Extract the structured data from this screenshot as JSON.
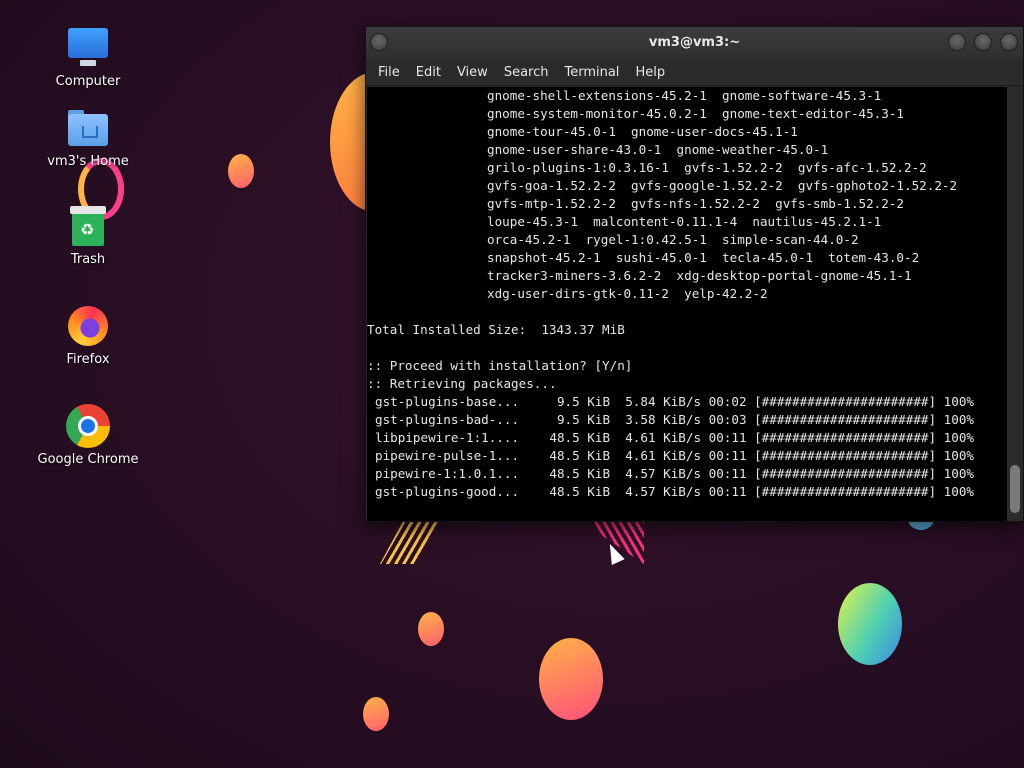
{
  "desktop": {
    "icons": [
      {
        "label": "Computer",
        "icon": "computer-icon"
      },
      {
        "label": "vm3's Home",
        "icon": "home-folder-icon"
      },
      {
        "label": "Trash",
        "icon": "trash-icon"
      },
      {
        "label": "Firefox",
        "icon": "firefox-icon"
      },
      {
        "label": "Google Chrome",
        "icon": "chrome-icon"
      }
    ]
  },
  "window": {
    "title": "vm3@vm3:~",
    "menu": [
      "File",
      "Edit",
      "View",
      "Search",
      "Terminal",
      "Help"
    ]
  },
  "terminal": {
    "package_lines": [
      "gnome-shell-extensions-45.2-1  gnome-software-45.3-1",
      "gnome-system-monitor-45.0.2-1  gnome-text-editor-45.3-1",
      "gnome-tour-45.0-1  gnome-user-docs-45.1-1",
      "gnome-user-share-43.0-1  gnome-weather-45.0-1",
      "grilo-plugins-1:0.3.16-1  gvfs-1.52.2-2  gvfs-afc-1.52.2-2",
      "gvfs-goa-1.52.2-2  gvfs-google-1.52.2-2  gvfs-gphoto2-1.52.2-2",
      "gvfs-mtp-1.52.2-2  gvfs-nfs-1.52.2-2  gvfs-smb-1.52.2-2",
      "loupe-45.3-1  malcontent-0.11.1-4  nautilus-45.2.1-1",
      "orca-45.2-1  rygel-1:0.42.5-1  simple-scan-44.0-2",
      "snapshot-45.2-1  sushi-45.0-1  tecla-45.0-1  totem-43.0-2",
      "tracker3-miners-3.6.2-2  xdg-desktop-portal-gnome-45.1-1",
      "xdg-user-dirs-gtk-0.11-2  yelp-42.2-2"
    ],
    "total_size": "Total Installed Size:  1343.37 MiB",
    "prompt": ":: Proceed with installation? [Y/n]",
    "retrieving": ":: Retrieving packages...",
    "downloads": [
      "gst-plugins-base...     9.5 KiB  5.84 KiB/s 00:02 [######################] 100%",
      "gst-plugins-bad-...     9.5 KiB  3.58 KiB/s 00:03 [######################] 100%",
      "libpipewire-1:1....    48.5 KiB  4.61 KiB/s 00:11 [######################] 100%",
      "pipewire-pulse-1...    48.5 KiB  4.61 KiB/s 00:11 [######################] 100%",
      "pipewire-1:1.0.1...    48.5 KiB  4.57 KiB/s 00:11 [######################] 100%",
      "gst-plugins-good...    48.5 KiB  4.57 KiB/s 00:11 [######################] 100%"
    ]
  }
}
